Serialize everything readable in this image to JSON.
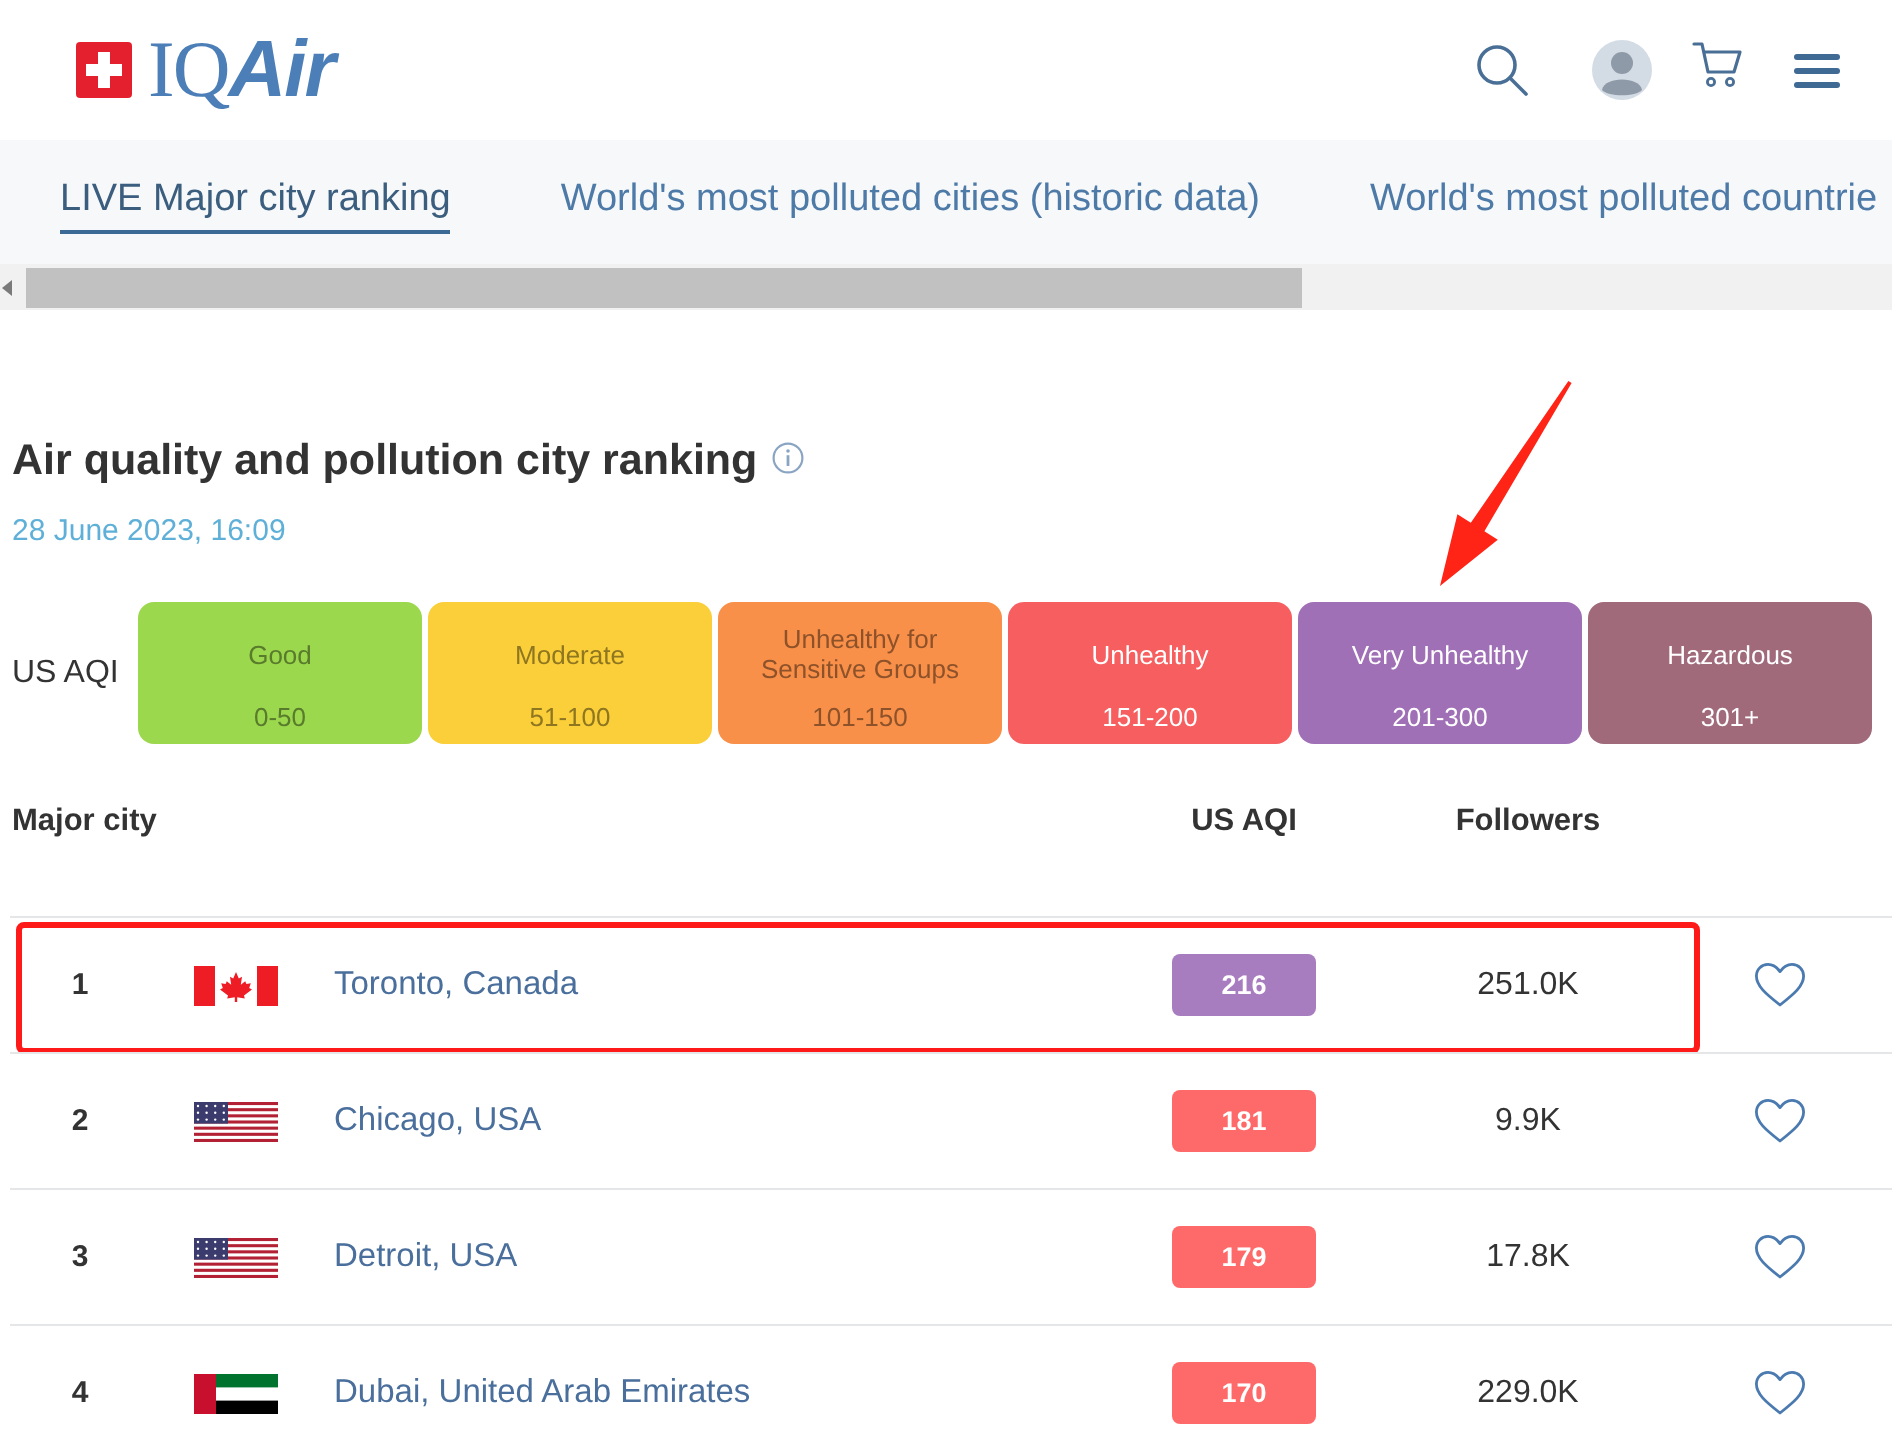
{
  "header": {
    "logo": "IQ**Air**"
  },
  "tabs": [
    {
      "label": "LIVE Major city ranking",
      "selected": true
    },
    {
      "label": "World's most polluted cities (historic data)",
      "selected": false
    },
    {
      "label": "World's most polluted countrie",
      "selected": false
    }
  ],
  "ranking": {
    "title": "Air quality and pollution city ranking",
    "updated": "28 June 2023, 16:09"
  },
  "legend": {
    "label": "US AQI",
    "levels": [
      {
        "name": "Good",
        "range": "0-50",
        "color": "#9cd84e",
        "pointed": false
      },
      {
        "name": "Moderate",
        "range": "51-100",
        "color": "#facf39",
        "pointed": false
      },
      {
        "name": "Unhealthy for Sensitive Groups",
        "range": "101-150",
        "color": "#f99049",
        "pointed": false
      },
      {
        "name": "Unhealthy",
        "range": "151-200",
        "color": "#f65e5f",
        "pointed": false
      },
      {
        "name": "Very Unhealthy",
        "range": "201-300",
        "color": "#a070b6",
        "pointed": true
      },
      {
        "name": "Hazardous",
        "range": "301+",
        "color": "#a06a7b",
        "pointed": false
      }
    ]
  },
  "table": {
    "columns": [
      "Major city",
      "US AQI",
      "Followers"
    ],
    "rows": [
      {
        "rank": "1",
        "flag": {
          "kind": "canada"
        },
        "city": "Toronto, Canada",
        "aqi": {
          "value": "216",
          "color": "#a87dbf"
        },
        "followers": "251.0K",
        "followed": false,
        "highlighted": true
      },
      {
        "rank": "2",
        "flag": {
          "kind": "usa"
        },
        "city": "Chicago, USA",
        "aqi": {
          "value": "181",
          "color": "#fe6a69"
        },
        "followers": "9.9K",
        "followed": false,
        "highlighted": false
      },
      {
        "rank": "3",
        "flag": {
          "kind": "usa"
        },
        "city": "Detroit, USA",
        "aqi": {
          "value": "179",
          "color": "#fe6a69"
        },
        "followers": "17.8K",
        "followed": false,
        "highlighted": false
      },
      {
        "rank": "4",
        "flag": {
          "kind": "uae"
        },
        "city": "Dubai, United Arab Emirates",
        "aqi": {
          "value": "170",
          "color": "#fe6a69"
        },
        "followers": "229.0K",
        "followed": false,
        "highlighted": false
      }
    ]
  }
}
